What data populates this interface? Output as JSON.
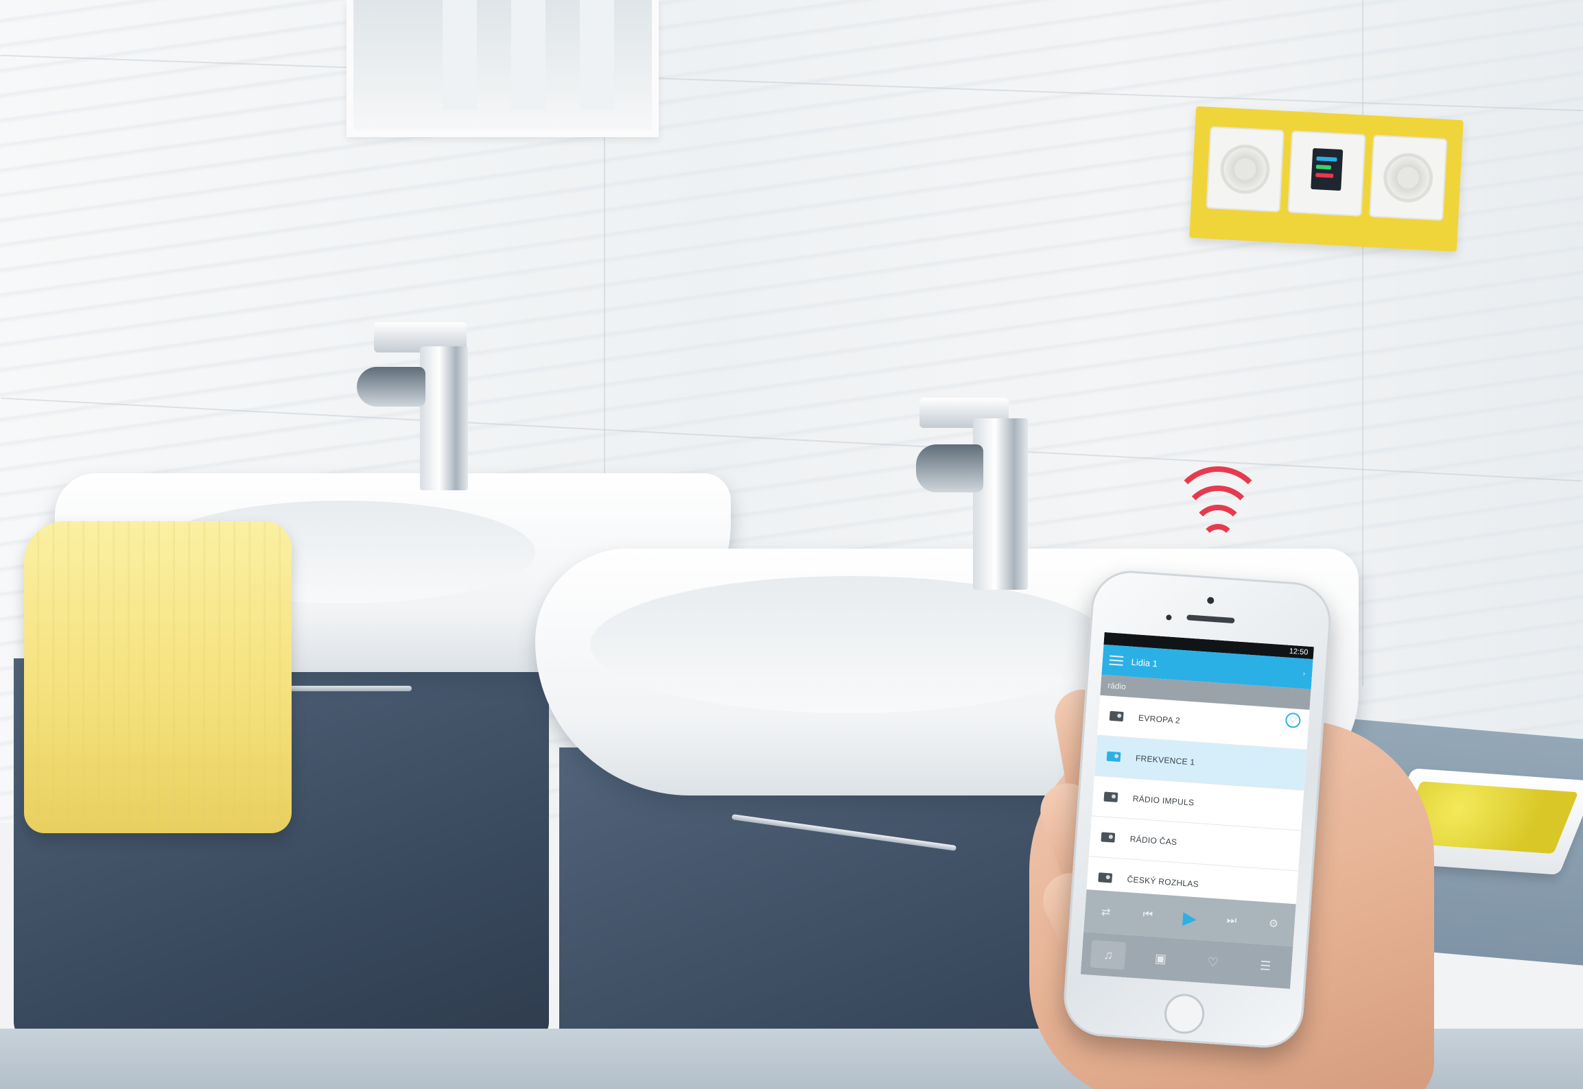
{
  "phone_app": {
    "status_time": "12:50",
    "header_title": "Lidia 1",
    "header_right": "",
    "section_title": "rádio",
    "stations": [
      {
        "label": "EVROPA 2",
        "favorite": true,
        "active": false
      },
      {
        "label": "FREKVENCE 1",
        "favorite": false,
        "active": true
      },
      {
        "label": "RÁDIO IMPULS",
        "favorite": false,
        "active": false
      },
      {
        "label": "RÁDIO ČAS",
        "favorite": false,
        "active": false
      },
      {
        "label": "ČESKÝ ROZHLAS",
        "favorite": false,
        "active": false
      }
    ],
    "player_controls": [
      "shuffle-icon",
      "previous-icon",
      "play-icon",
      "next-icon",
      "settings-icon"
    ],
    "tabs": [
      "radio-tab-icon",
      "media-tab-icon",
      "favorites-tab-icon",
      "stations-tab-icon"
    ],
    "accent_color": "#2bb0e6"
  },
  "scene": {
    "wall_radio_frame_color": "#f0d53a",
    "signal_color": "#e63a4e",
    "towel_color": "#f4e07a",
    "cabinet_color": "#3a4a5f"
  }
}
